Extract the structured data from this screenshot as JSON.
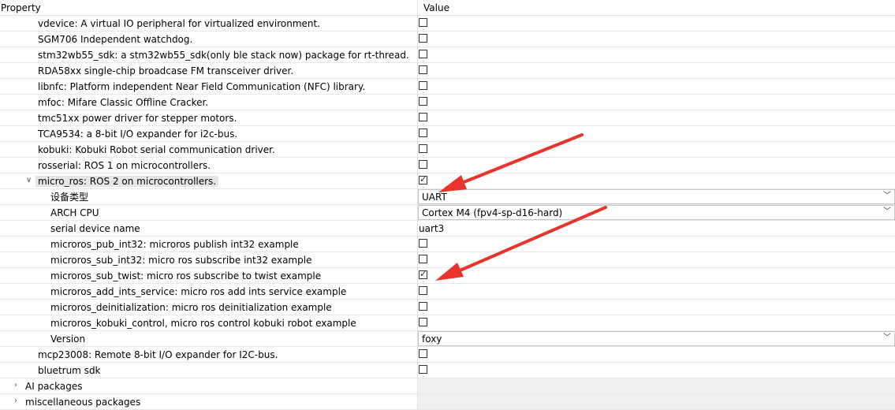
{
  "header": {
    "property": "Property",
    "value": "Value"
  },
  "rows": [
    {
      "label": "vdevice: A virtual IO peripheral for virtualized environment.",
      "indent": 1,
      "type": "checkbox",
      "checked": false
    },
    {
      "label": "SGM706 Independent watchdog.",
      "indent": 1,
      "type": "checkbox",
      "checked": false
    },
    {
      "label": "stm32wb55_sdk: a stm32wb55_sdk(only ble stack now) package for rt-thread.",
      "indent": 1,
      "type": "checkbox",
      "checked": false
    },
    {
      "label": "RDA58xx single-chip broadcase FM transceiver driver.",
      "indent": 1,
      "type": "checkbox",
      "checked": false
    },
    {
      "label": "libnfc: Platform independent Near Field Communication (NFC) library.",
      "indent": 1,
      "type": "checkbox",
      "checked": false
    },
    {
      "label": "mfoc: Mifare Classic Offline Cracker.",
      "indent": 1,
      "type": "checkbox",
      "checked": false
    },
    {
      "label": "tmc51xx power driver for stepper motors.",
      "indent": 1,
      "type": "checkbox",
      "checked": false
    },
    {
      "label": "TCA9534: a 8-bit I/O expander for i2c-bus.",
      "indent": 1,
      "type": "checkbox",
      "checked": false
    },
    {
      "label": "kobuki: Kobuki Robot serial communication driver.",
      "indent": 1,
      "type": "checkbox",
      "checked": false
    },
    {
      "label": "rosserial: ROS 1 on microcontrollers.",
      "indent": 1,
      "type": "checkbox",
      "checked": false
    },
    {
      "label": "micro_ros: ROS 2 on microcontrollers.",
      "indent": 1,
      "type": "checkbox",
      "checked": true,
      "expanded": true,
      "selected": true
    },
    {
      "label": "设备类型",
      "indent": 2,
      "type": "select",
      "value": "UART"
    },
    {
      "label": "ARCH CPU",
      "indent": 2,
      "type": "select",
      "value": "Cortex M4 (fpv4-sp-d16-hard)"
    },
    {
      "label": "serial device name",
      "indent": 2,
      "type": "text",
      "value": "uart3"
    },
    {
      "label": "microros_pub_int32: microros publish int32 example",
      "indent": 2,
      "type": "checkbox",
      "checked": false
    },
    {
      "label": "microros_sub_int32: micro ros subscribe int32 example",
      "indent": 2,
      "type": "checkbox",
      "checked": false
    },
    {
      "label": "microros_sub_twist: micro ros subscribe to twist example",
      "indent": 2,
      "type": "checkbox",
      "checked": true
    },
    {
      "label": "microros_add_ints_service: micro ros add ints service example",
      "indent": 2,
      "type": "checkbox",
      "checked": false
    },
    {
      "label": "microros_deinitialization: micro ros deinitialization example",
      "indent": 2,
      "type": "checkbox",
      "checked": false
    },
    {
      "label": "microros_kobuki_control, micro ros control kobuki robot example",
      "indent": 2,
      "type": "checkbox",
      "checked": false
    },
    {
      "label": "Version",
      "indent": 2,
      "type": "select",
      "value": "foxy"
    },
    {
      "label": "mcp23008: Remote 8-bit I/O expander for I2C-bus.",
      "indent": 1,
      "type": "checkbox",
      "checked": false
    },
    {
      "label": "bluetrum sdk",
      "indent": 1,
      "type": "checkbox",
      "checked": false
    },
    {
      "label": "AI packages",
      "indent": 0,
      "type": "group",
      "expanded": false
    },
    {
      "label": "miscellaneous packages",
      "indent": 0,
      "type": "group",
      "expanded": false
    }
  ],
  "icons": {
    "check": "✓",
    "chevron_down": "﹀",
    "chevron_right": "›",
    "chevron_open": "∨"
  },
  "colors": {
    "arrow": "#e8342a",
    "selected_row": "#e6e6e6",
    "group_fill": "#f0f0f0"
  }
}
